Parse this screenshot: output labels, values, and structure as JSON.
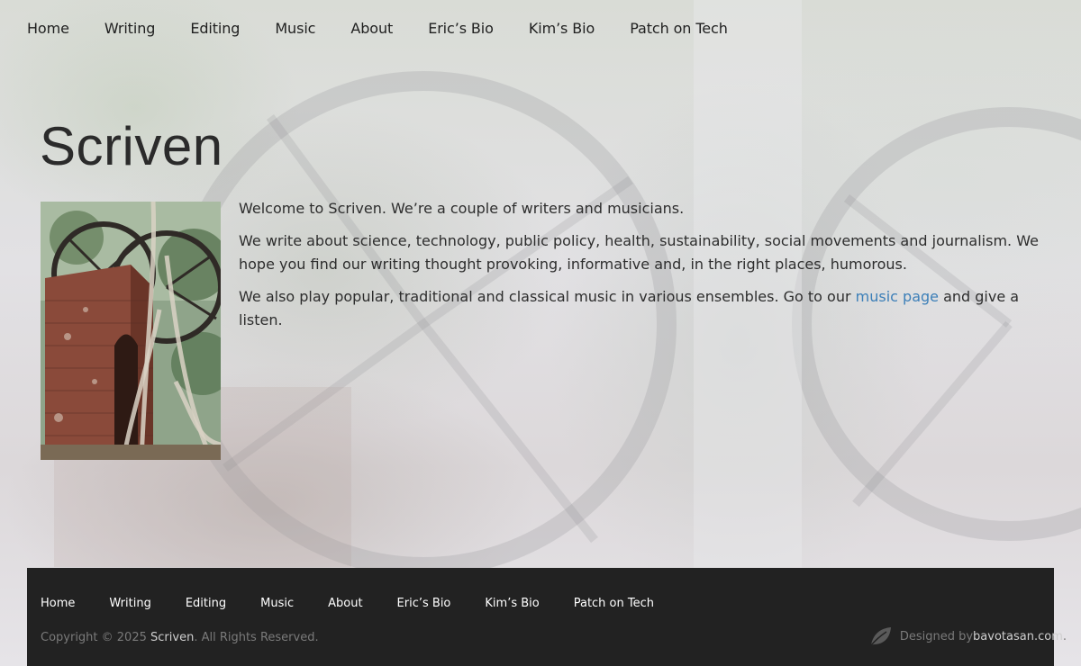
{
  "nav": {
    "items": [
      {
        "label": "Home"
      },
      {
        "label": "Writing"
      },
      {
        "label": "Editing"
      },
      {
        "label": "Music"
      },
      {
        "label": "About"
      },
      {
        "label": "Eric’s Bio"
      },
      {
        "label": "Kim’s Bio"
      },
      {
        "label": "Patch on Tech"
      }
    ]
  },
  "site": {
    "title": "Scriven"
  },
  "main": {
    "image_alt": "brick ruin with tree roots and old iron wheel",
    "p1": "Welcome to Scriven. We’re a couple of writers and musicians.",
    "p2": "We write about science, technology, public policy, health, sustainability, social movements and journalism. We hope you find our writing thought provoking, informative and, in the right places, humorous.",
    "p3_before": "We also play popular, traditional and classical music in various ensembles. Go to our ",
    "p3_link": "music page",
    "p3_after": " and give a listen."
  },
  "footer": {
    "nav": [
      {
        "label": "Home"
      },
      {
        "label": "Writing"
      },
      {
        "label": "Editing"
      },
      {
        "label": "Music"
      },
      {
        "label": "About"
      },
      {
        "label": "Eric’s Bio"
      },
      {
        "label": "Kim’s Bio"
      },
      {
        "label": "Patch on Tech"
      }
    ],
    "copyright_prefix": "Copyright © 2025 ",
    "copyright_site": "Scriven",
    "copyright_suffix": ". All Rights Reserved.",
    "credit_prefix": "Designed by ",
    "credit_link": "bavotasan.com",
    "credit_suffix": ".",
    "credit_icon": "leaf-icon"
  },
  "colors": {
    "link": "#3c7fb8",
    "footer_bg": "#222222",
    "text": "#2d2d2d"
  }
}
